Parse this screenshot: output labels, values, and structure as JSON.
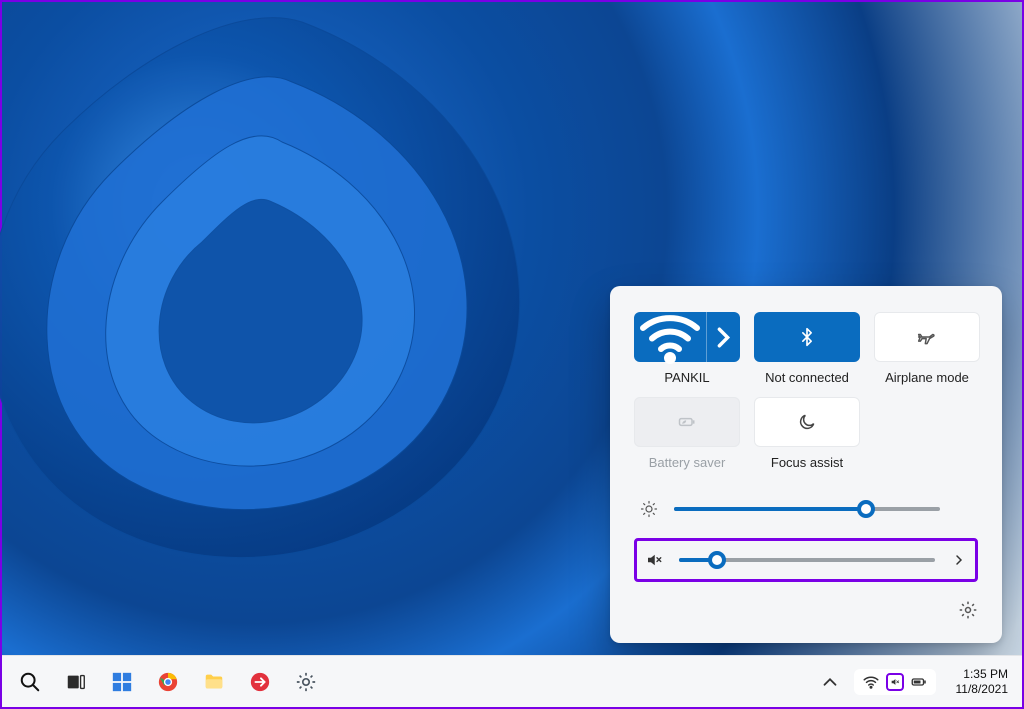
{
  "quick_settings": {
    "wifi": {
      "label": "PANKIL",
      "active": true
    },
    "bluetooth": {
      "label": "Not connected",
      "active": true
    },
    "airplane": {
      "label": "Airplane mode",
      "active": false
    },
    "battery_saver": {
      "label": "Battery saver",
      "disabled": true
    },
    "focus_assist": {
      "label": "Focus assist",
      "active": false
    },
    "brightness_percent": 72,
    "volume_percent": 15,
    "volume_muted": true
  },
  "taskbar": {
    "time": "1:35 PM",
    "date": "11/8/2021"
  }
}
